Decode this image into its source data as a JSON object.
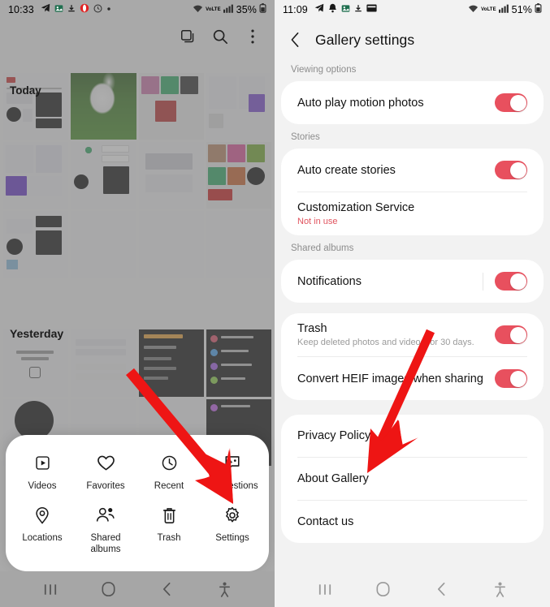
{
  "left": {
    "status_bar": {
      "time": "10:33",
      "icons": [
        "telegram-icon",
        "photo-icon",
        "download-icon",
        "opera-icon",
        "clock-icon",
        "dot-icon"
      ],
      "wifi": "wifi-icon",
      "network": "VoLTE",
      "signal": "signal-icon",
      "battery_percent": "35%",
      "battery": "battery-icon"
    },
    "toolbar": {
      "copy_icon": "stack-icon",
      "search_icon": "search-icon",
      "more_icon": "more-vertical-icon"
    },
    "sections": [
      {
        "label": "Today"
      },
      {
        "label": "Yesterday"
      }
    ],
    "sheet": {
      "items": [
        {
          "label": "Videos",
          "icon": "video-play-icon"
        },
        {
          "label": "Favorites",
          "icon": "heart-icon"
        },
        {
          "label": "Recent",
          "icon": "clock-icon"
        },
        {
          "label": "Suggestions",
          "icon": "sparkle-chat-icon"
        },
        {
          "label": "Locations",
          "icon": "location-pin-icon"
        },
        {
          "label": "Shared\nalbums",
          "icon": "people-icon"
        },
        {
          "label": "Trash",
          "icon": "trash-icon"
        },
        {
          "label": "Settings",
          "icon": "gear-icon"
        }
      ]
    },
    "navbar": {
      "recents": "recents-icon",
      "home": "home-icon",
      "back": "back-icon",
      "accessibility": "accessibility-icon"
    }
  },
  "right": {
    "status_bar": {
      "time": "11:09",
      "icons": [
        "telegram-icon",
        "bell-icon",
        "photo-icon",
        "download-icon",
        "card-icon"
      ],
      "wifi": "wifi-icon",
      "network": "VoLTE",
      "signal": "signal-icon",
      "battery_percent": "51%",
      "battery": "battery-icon"
    },
    "appbar": {
      "back_icon": "back-chevron-icon",
      "title": "Gallery settings"
    },
    "groups": [
      {
        "label": "Viewing options",
        "rows": [
          {
            "title": "Auto play motion photos",
            "sub": "",
            "toggle": true,
            "toggle_on": true
          }
        ]
      },
      {
        "label": "Stories",
        "rows": [
          {
            "title": "Auto create stories",
            "sub": "",
            "toggle": true,
            "toggle_on": true
          },
          {
            "title": "Customization Service",
            "sub": "Not in use",
            "toggle": false,
            "toggle_on": false
          }
        ]
      },
      {
        "label": "Shared albums",
        "rows": [
          {
            "title": "Notifications",
            "sub": "",
            "toggle": true,
            "toggle_on": true
          }
        ]
      },
      {
        "label": "",
        "rows": [
          {
            "title": "Trash",
            "sub": "Keep deleted photos and videos for 30 days.",
            "toggle": true,
            "toggle_on": true
          },
          {
            "title": "Convert HEIF images when sharing",
            "sub": "",
            "toggle": true,
            "toggle_on": true
          }
        ]
      },
      {
        "label": "",
        "rows": [
          {
            "title": "Privacy Policy",
            "sub": "",
            "toggle": false,
            "toggle_on": false
          },
          {
            "title": "About Gallery",
            "sub": "",
            "toggle": false,
            "toggle_on": false
          },
          {
            "title": "Contact us",
            "sub": "",
            "toggle": false,
            "toggle_on": false
          }
        ]
      }
    ],
    "navbar": {
      "recents": "recents-icon",
      "home": "home-icon",
      "back": "back-icon",
      "accessibility": "accessibility-icon"
    }
  },
  "annotations": {
    "arrow_color": "#ee1514",
    "left_arrow_target": "Settings",
    "right_arrow_target": "About Gallery"
  },
  "colors": {
    "toggle_on": "#e8505e",
    "warn_text": "#e0535e",
    "arrow": "#ee1514",
    "card_bg": "#ffffff",
    "page_bg": "#f2f2f2"
  }
}
